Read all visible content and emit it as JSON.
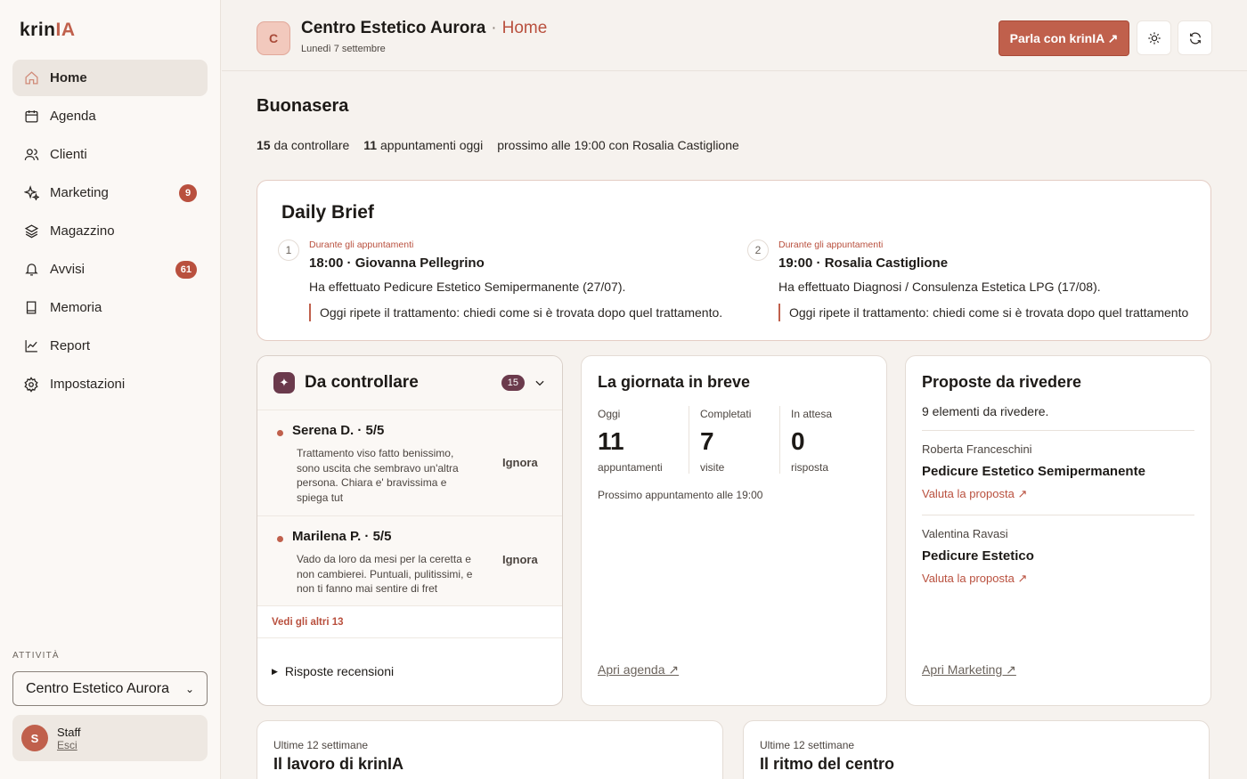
{
  "sidebar": {
    "logo_main": "krin",
    "logo_accent": "IA",
    "items": [
      {
        "label": "Home",
        "icon": "home-icon"
      },
      {
        "label": "Agenda",
        "icon": "calendar-icon"
      },
      {
        "label": "Clienti",
        "icon": "users-icon"
      },
      {
        "label": "Marketing",
        "icon": "sparkles-icon",
        "badge": "9"
      },
      {
        "label": "Magazzino",
        "icon": "layers-icon"
      },
      {
        "label": "Avvisi",
        "icon": "bell-icon",
        "badge": "61"
      },
      {
        "label": "Memoria",
        "icon": "book-icon"
      },
      {
        "label": "Report",
        "icon": "chart-line-icon"
      },
      {
        "label": "Impostazioni",
        "icon": "gear-icon"
      }
    ],
    "activity_label": "ATTIVITÀ",
    "activity_selected": "Centro Estetico Aurora",
    "staff_initial": "S",
    "staff_name": "Staff",
    "logout": "Esci"
  },
  "header": {
    "initial": "C",
    "business": "Centro Estetico Aurora",
    "separator": "·",
    "page": "Home",
    "date": "Lunedì 7 settembre",
    "cta": "Parla con krinIA ↗"
  },
  "greeting": "Buonasera",
  "stats": {
    "to_review_num": "15",
    "to_review_label": "da controllare",
    "appts_num": "11",
    "appts_label": "appuntamenti oggi",
    "next": "prossimo alle 19:00 con Rosalia Castiglione"
  },
  "brief": {
    "title": "Daily Brief",
    "items": [
      {
        "num": "1",
        "category": "Durante gli appuntamenti",
        "title": "18:00 · Giovanna Pellegrino",
        "desc": "Ha effettuato Pedicure Estetico Semipermanente (27/07).",
        "note": "Oggi ripete il trattamento: chiedi come si è trovata dopo quel trattamento."
      },
      {
        "num": "2",
        "category": "Durante gli appuntamenti",
        "title": "19:00 · Rosalia Castiglione",
        "desc": "Ha effettuato Diagnosi / Consulenza Estetica LPG (17/08).",
        "note": "Oggi ripete il trattamento: chiedi come si è trovata dopo quel trattamento"
      }
    ]
  },
  "controllare": {
    "title": "Da controllare",
    "count": "15",
    "reviews": [
      {
        "name": "Serena D. · 5/5",
        "text": "Trattamento viso fatto benissimo, sono uscita che sembravo un'altra persona. Chiara e' bravissima e spiega tut",
        "action": "Ignora"
      },
      {
        "name": "Marilena P. · 5/5",
        "text": "Vado da loro da mesi per la ceretta e non cambierei. Puntuali, pulitissimi, e non ti fanno mai sentire di fret",
        "action": "Ignora"
      }
    ],
    "more": "Vedi gli altri 13",
    "replies": "Risposte recensioni"
  },
  "giornata": {
    "title": "La giornata in breve",
    "cols": [
      {
        "label": "Oggi",
        "value": "11",
        "sub": "appuntamenti"
      },
      {
        "label": "Completati",
        "value": "7",
        "sub": "visite"
      },
      {
        "label": "In attesa",
        "value": "0",
        "sub": "risposta"
      }
    ],
    "next": "Prossimo appuntamento alle 19:00",
    "link": "Apri agenda ↗"
  },
  "proposte": {
    "title": "Proposte da rivedere",
    "count": "9 elementi da rivedere.",
    "items": [
      {
        "client": "Roberta Franceschini",
        "treatment": "Pedicure Estetico Semipermanente",
        "action": "Valuta la proposta ↗"
      },
      {
        "client": "Valentina Ravasi",
        "treatment": "Pedicure Estetico",
        "action": "Valuta la proposta ↗"
      }
    ],
    "link": "Apri Marketing ↗"
  },
  "bottom": [
    {
      "sub": "Ultime 12 settimane",
      "title": "Il lavoro di krinIA"
    },
    {
      "sub": "Ultime 12 settimane",
      "title": "Il ritmo del centro"
    }
  ],
  "colors": {
    "accent": "#c0604c",
    "badge": "#b9503e",
    "plum": "#6b3a4c"
  }
}
